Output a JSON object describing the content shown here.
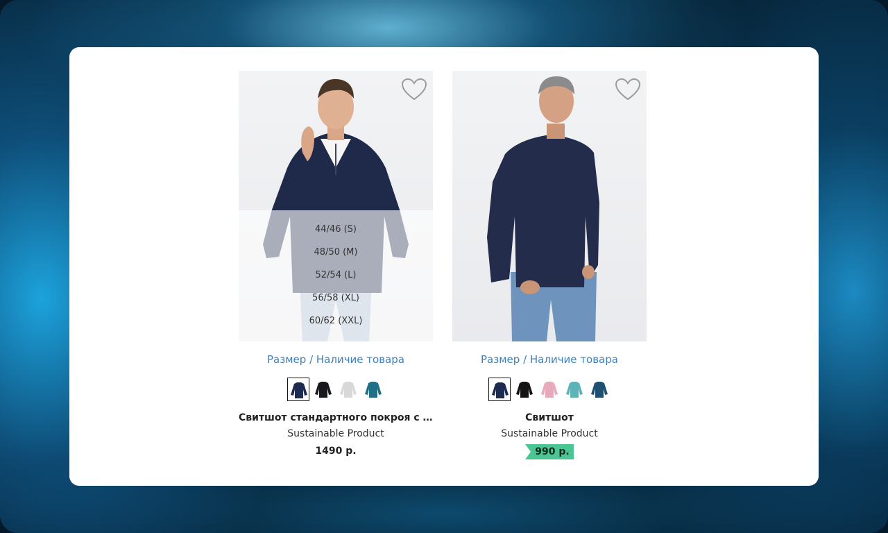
{
  "products": [
    {
      "name": "Свитшот стандартного покроя с ...",
      "subtitle": "Sustainable Product",
      "price": "1490 р.",
      "availability_link": "Размер / Наличие товара",
      "sizes": [
        "44/46 (S)",
        "48/50 (M)",
        "52/54 (L)",
        "56/58 (XL)",
        "60/62 (XXL)"
      ],
      "swatch_colors": [
        "#1d2b52",
        "#18191d",
        "#d8d8d8",
        "#1f6f86"
      ],
      "selected_swatch": 0,
      "price_highlight": false
    },
    {
      "name": "Свитшот",
      "subtitle": "Sustainable Product",
      "price": "990 р.",
      "availability_link": "Размер / Наличие товара",
      "swatch_colors": [
        "#1d2b52",
        "#141414",
        "#e9a9bd",
        "#5cb3b8",
        "#1d4f72"
      ],
      "selected_swatch": 0,
      "price_highlight": true,
      "price_highlight_color": "#4cc594"
    }
  ],
  "icons": {
    "wishlist": "heart-outline-icon"
  }
}
